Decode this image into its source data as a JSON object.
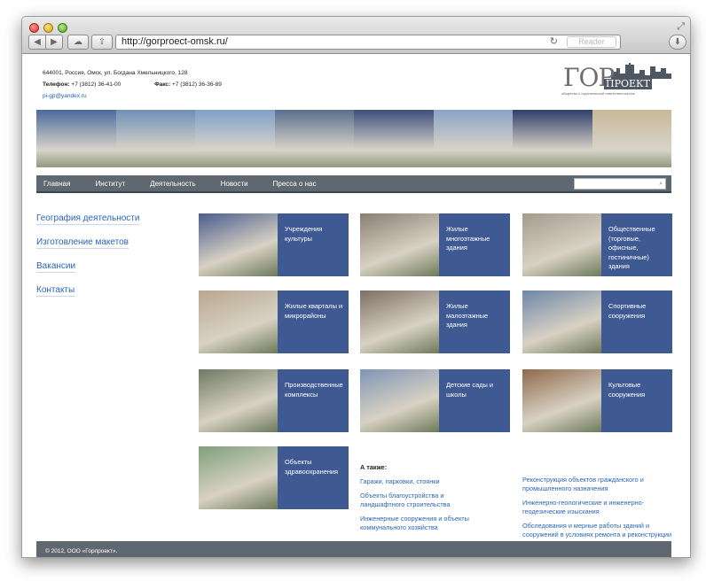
{
  "browser": {
    "url": "http://gorproect-omsk.ru/",
    "reader_label": "Reader"
  },
  "header": {
    "address": "644001, Россия, Омск, ул. Богдана Хмельницкого, 128",
    "phone_label": "Телефон:",
    "phone": "+7 (3812) 36-41-00",
    "fax_label": "Факс:",
    "fax": "+7 (3812) 36-36-89",
    "email": "pi-gp@yandex.ru"
  },
  "logo": {
    "main": "ГОР",
    "sub": "ПРОЕКТ",
    "caption": "общество с ограниченной ответственностью"
  },
  "banner_colors": [
    "#4a6b9c",
    "#6f8fb6",
    "#7fa0c8",
    "#5a6f8e",
    "#3d4f7e",
    "#8aa3c6",
    "#2f3f6a",
    "#c8b89a"
  ],
  "navigation": {
    "items": [
      "Главная",
      "Институт",
      "Деятельность",
      "Новости",
      "Пресса о нас"
    ],
    "search_placeholder": ""
  },
  "sidebar": {
    "links": [
      "География деятельности",
      "Изготовление макетов",
      "Вакансии",
      "Контакты"
    ]
  },
  "tiles": [
    {
      "label": "Учреждения культуры",
      "photo": "#4b5d8e"
    },
    {
      "label": "Жилые многоэтажные здания",
      "photo": "#8a7e72"
    },
    {
      "label": "Общественные (торговые, офисные, гостиничные) здания",
      "photo": "#a39a8c"
    },
    {
      "label": "Жилые кварталы и микрорайоны",
      "photo": "#b9a78f"
    },
    {
      "label": "Жилые малоэтажные здания",
      "photo": "#7e6f63"
    },
    {
      "label": "Спортивные сооружения",
      "photo": "#6f86a8"
    },
    {
      "label": "Производственные комплексы",
      "photo": "#6f7a64"
    },
    {
      "label": "Детские сады и школы",
      "photo": "#7f95b5"
    },
    {
      "label": "Культовые сооружения",
      "photo": "#8f6a4b"
    },
    {
      "label": "Объекты здравоохранения",
      "photo": "#7fa07a"
    }
  ],
  "also": {
    "title": "А также:",
    "left_links": [
      "Гаражи, парковки, стоянки",
      "Объекты благоустройства и ландшафтного строительства",
      "Инженерные сооружения и объекты коммунального хозяйства"
    ],
    "right_links": [
      "Реконструкция объектов гражданского и промышленного назначения",
      "Инженерно-геологические и инженерно-геодезические изыскания",
      "Обследования и мерные работы зданий и сооружений в условиях ремонта и реконструкции"
    ]
  },
  "footer": {
    "copyright": "© 2012, ООО «Горпроект»."
  }
}
